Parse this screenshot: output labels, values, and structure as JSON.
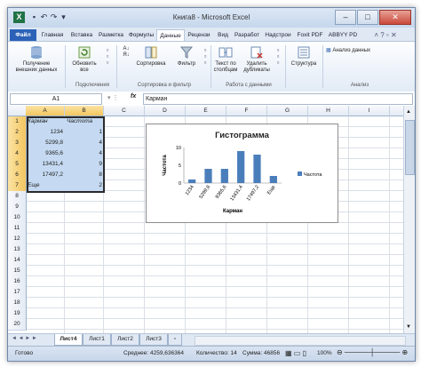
{
  "window": {
    "title": "Книга8 - Microsoft Excel",
    "app_icon": "X"
  },
  "tabs": [
    "Файл",
    "Главная",
    "Вставка",
    "Разметка",
    "Формулы",
    "Данные",
    "Рецензи",
    "Вид",
    "Разработ",
    "Надстрои",
    "Foxit PDF",
    "ABBYY PD"
  ],
  "ribbon": {
    "get_external": "Получение внешних данных",
    "refresh_all": "Обновить все",
    "sort": "Сортировка",
    "filter": "Фильтр",
    "text_to_columns": "Текст по столбцам",
    "remove_duplicates": "Удалить дубликаты",
    "outline": "Структура",
    "data_analysis": "Анализ данных",
    "group_connections": "Подключения",
    "group_sort_filter": "Сортировка и фильтр",
    "group_data_tools": "Работа с данными",
    "group_analysis": "Анализ"
  },
  "formula_bar": {
    "name_box": "A1",
    "fx": "fx",
    "value": "Карман"
  },
  "columns": [
    "A",
    "B",
    "C",
    "D",
    "E",
    "F",
    "G",
    "H",
    "I",
    "J"
  ],
  "rows": [
    "1",
    "2",
    "3",
    "4",
    "5",
    "6",
    "7",
    "8",
    "9",
    "10",
    "11",
    "12",
    "13",
    "14",
    "15",
    "16",
    "17",
    "18",
    "19",
    "20"
  ],
  "table": {
    "header": [
      "Карман",
      "Частота"
    ],
    "rows": [
      [
        "1234",
        "1"
      ],
      [
        "5299,8",
        "4"
      ],
      [
        "9365,6",
        "4"
      ],
      [
        "13431,4",
        "9"
      ],
      [
        "17497,2",
        "8"
      ],
      [
        "Еще",
        "2"
      ]
    ]
  },
  "chart_data": {
    "type": "bar",
    "title": "Гистограмма",
    "xlabel": "Карман",
    "ylabel": "Частота",
    "categories": [
      "1234",
      "5299,8",
      "9365,6",
      "13431,4",
      "17497,2",
      "Еще"
    ],
    "series": [
      {
        "name": "Частота",
        "values": [
          1,
          4,
          4,
          9,
          8,
          2
        ],
        "color": "#4a7ebb"
      }
    ],
    "ylim": [
      0,
      10
    ],
    "yticks": [
      "0",
      "5",
      "10"
    ],
    "legend": "right"
  },
  "sheets": [
    "Лист4",
    "Лист1",
    "Лист2",
    "Лист3"
  ],
  "status": {
    "mode": "Готово",
    "average": "Среднее: 4259,636364",
    "count": "Количество: 14",
    "sum": "Сумма: 46856",
    "zoom": "100%"
  }
}
